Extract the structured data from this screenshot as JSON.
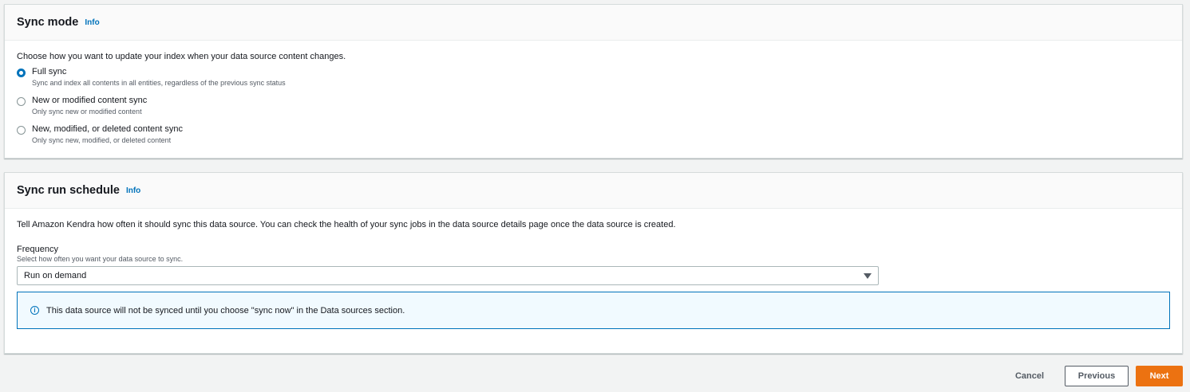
{
  "sync_mode": {
    "title": "Sync mode",
    "info_label": "Info",
    "description": "Choose how you want to update your index when your data source content changes.",
    "options": [
      {
        "label": "Full sync",
        "sub": "Sync and index all contents in all entities, regardless of the previous sync status",
        "selected": true
      },
      {
        "label": "New or modified content sync",
        "sub": "Only sync new or modified content",
        "selected": false
      },
      {
        "label": "New, modified, or deleted content sync",
        "sub": "Only sync new, modified, or deleted content",
        "selected": false
      }
    ]
  },
  "schedule": {
    "title": "Sync run schedule",
    "info_label": "Info",
    "description": "Tell Amazon Kendra how often it should sync this data source. You can check the health of your sync jobs in the data source details page once the data source is created.",
    "frequency_label": "Frequency",
    "frequency_sub": "Select how often you want your data source to sync.",
    "frequency_value": "Run on demand",
    "alert_text": "This data source will not be synced until you choose \"sync now\" in the Data sources section."
  },
  "footer": {
    "cancel_label": "Cancel",
    "previous_label": "Previous",
    "next_label": "Next"
  },
  "icons": {
    "info": "info-circle-icon",
    "caret": "caret-down-icon"
  },
  "colors": {
    "accent": "#0073bb",
    "primary_button": "#ec7211"
  }
}
